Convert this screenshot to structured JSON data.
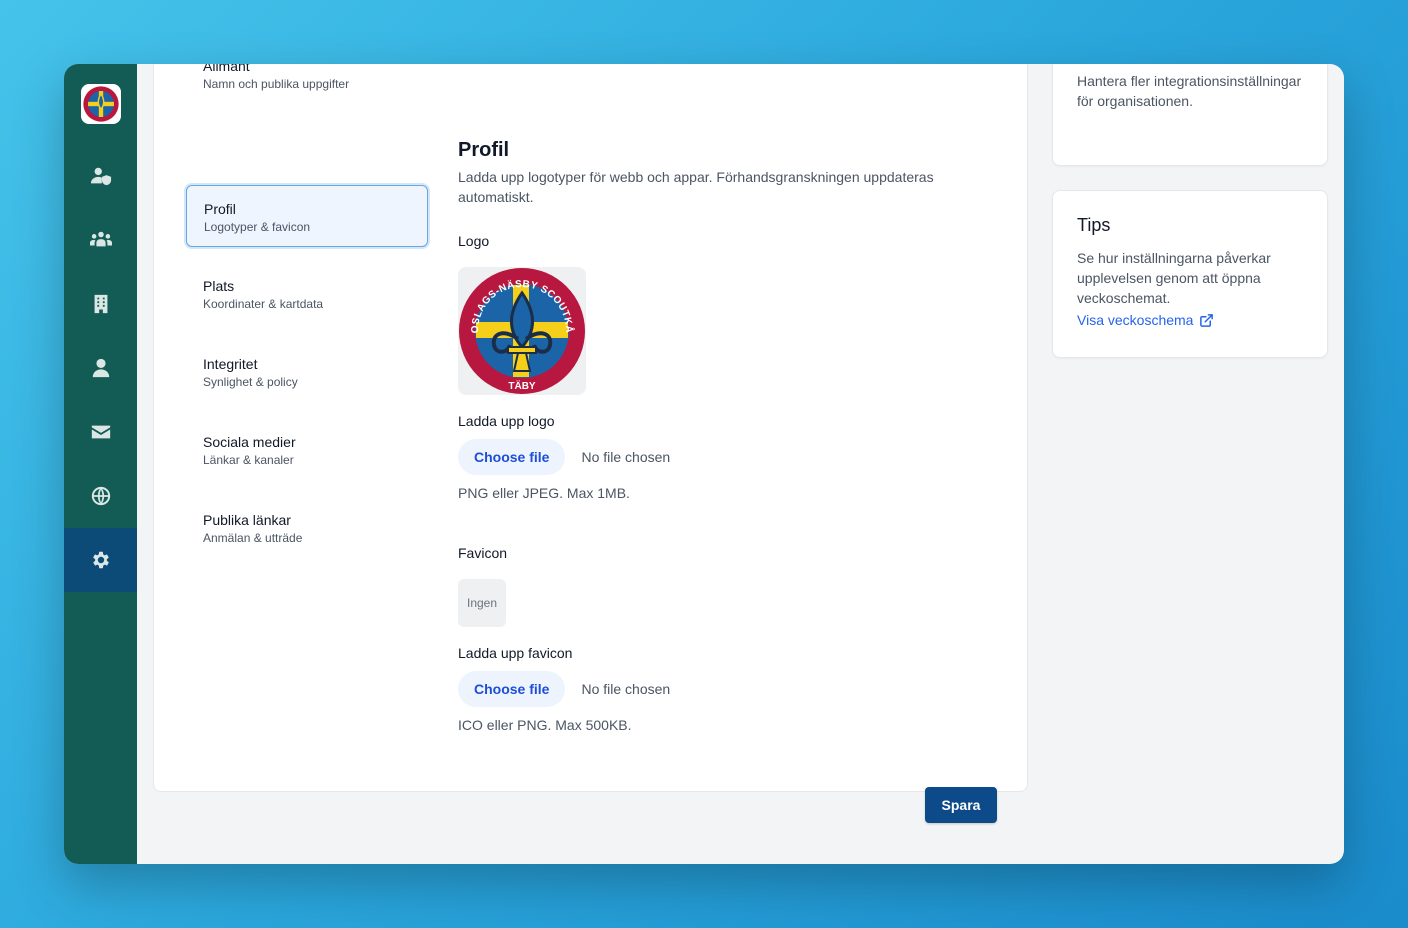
{
  "rail": {
    "items": [
      {
        "name": "user-shield-icon"
      },
      {
        "name": "users-icon"
      },
      {
        "name": "building-icon"
      },
      {
        "name": "user-icon"
      },
      {
        "name": "envelope-icon"
      },
      {
        "name": "globe-icon"
      },
      {
        "name": "gear-icon",
        "active": true
      }
    ],
    "colors": {
      "rail": "#125c55",
      "active": "#0c4a78"
    }
  },
  "nav": {
    "items": [
      {
        "title": "Allmänt",
        "sub": "Namn och publika uppgifter"
      },
      {
        "title": "Profil",
        "sub": "Logotyper & favicon",
        "active": true
      },
      {
        "title": "Plats",
        "sub": "Koordinater & kartdata"
      },
      {
        "title": "Integritet",
        "sub": "Synlighet & policy"
      },
      {
        "title": "Sociala medier",
        "sub": "Länkar & kanaler"
      },
      {
        "title": "Publika länkar",
        "sub": "Anmälan & utträde"
      }
    ]
  },
  "profile": {
    "title": "Profil",
    "description": "Ladda upp logotyper för webb och appar. Förhandsgranskningen uppdateras automatiskt.",
    "logo_label": "Logo",
    "logo_text_top": "ROSLAGS-NÄSBY SCOUTKÅR",
    "logo_text_bottom": "TÄBY",
    "upload_logo_label": "Ladda upp logo",
    "choose_file": "Choose file",
    "no_file": "No file chosen",
    "logo_hint": "PNG eller JPEG. Max 1MB.",
    "favicon_label": "Favicon",
    "favicon_placeholder": "Ingen",
    "upload_favicon_label": "Ladda upp favicon",
    "favicon_hint": "ICO eller PNG. Max 500KB.",
    "save": "Spara"
  },
  "integration_card": {
    "text": "Hantera fler integrationsinställningar för organisationen."
  },
  "tips": {
    "title": "Tips",
    "text": "Se hur inställningarna påverkar upplevelsen genom att öppna veckoschemat.",
    "link": "Visa veckoschema",
    "link_icon": "external-link-icon"
  }
}
